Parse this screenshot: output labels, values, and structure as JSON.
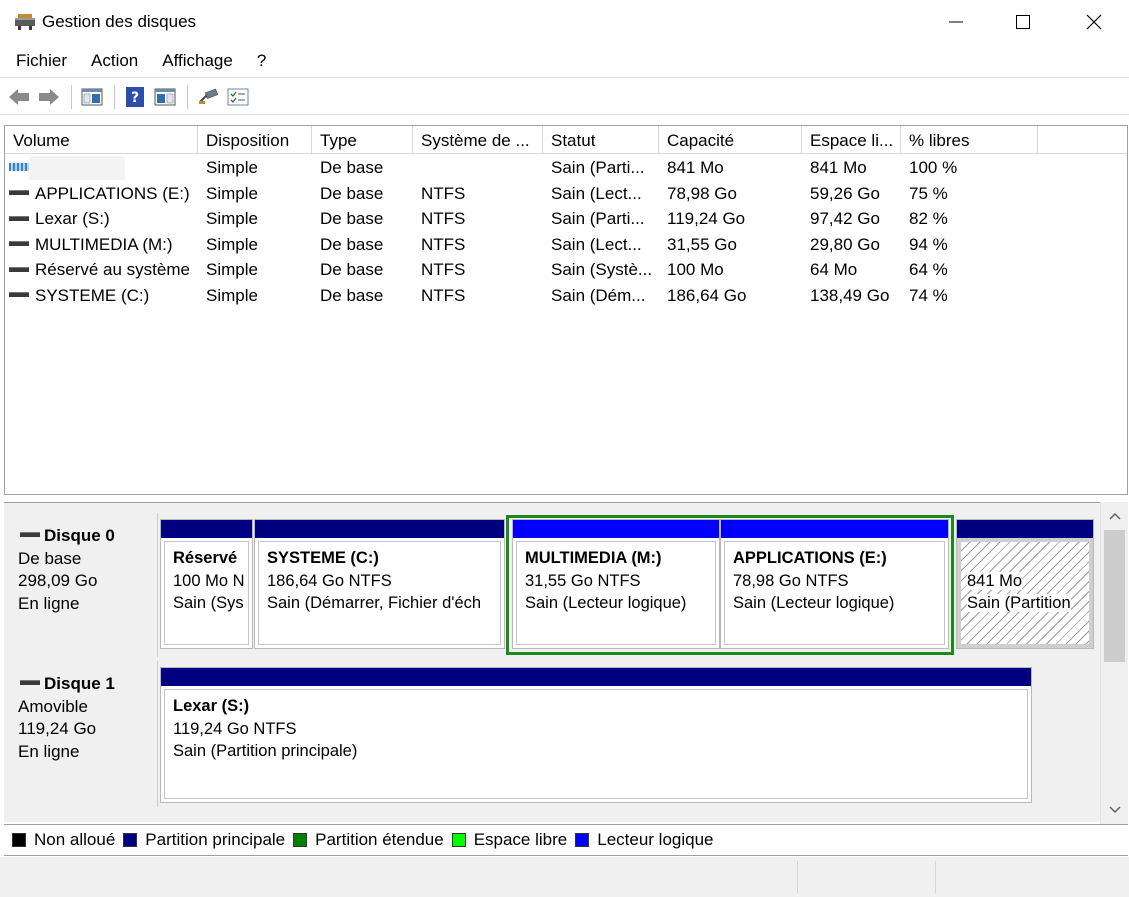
{
  "window": {
    "title": "Gestion des disques",
    "minimize": "—",
    "maximize": "☐",
    "close": "✕"
  },
  "menu": [
    "Fichier",
    "Action",
    "Affichage",
    "?"
  ],
  "toolbar": {
    "icons": [
      "back-arrow-icon",
      "forward-arrow-icon",
      "console-tree-icon",
      "help-icon",
      "properties-pane-icon",
      "connect-icon",
      "checklist-icon"
    ]
  },
  "table": {
    "columns": [
      "Volume",
      "Disposition",
      "Type",
      "Système de ...",
      "Statut",
      "Capacité",
      "Espace li...",
      "% libres"
    ],
    "rows": [
      {
        "volume": "",
        "disposition": "Simple",
        "type": "De base",
        "fs": "",
        "statut": "Sain (Parti...",
        "capacite": "841 Mo",
        "espace": "841 Mo",
        "pct": "100 %"
      },
      {
        "volume": "APPLICATIONS (E:)",
        "disposition": "Simple",
        "type": "De base",
        "fs": "NTFS",
        "statut": "Sain (Lect...",
        "capacite": "78,98 Go",
        "espace": "59,26 Go",
        "pct": "75 %"
      },
      {
        "volume": "Lexar (S:)",
        "disposition": "Simple",
        "type": "De base",
        "fs": "NTFS",
        "statut": "Sain (Parti...",
        "capacite": "119,24 Go",
        "espace": "97,42 Go",
        "pct": "82 %"
      },
      {
        "volume": "MULTIMEDIA (M:)",
        "disposition": "Simple",
        "type": "De base",
        "fs": "NTFS",
        "statut": "Sain (Lect...",
        "capacite": "31,55 Go",
        "espace": "29,80 Go",
        "pct": "94 %"
      },
      {
        "volume": "Réservé au système",
        "disposition": "Simple",
        "type": "De base",
        "fs": "NTFS",
        "statut": "Sain (Systè...",
        "capacite": "100 Mo",
        "espace": "64 Mo",
        "pct": "64 %"
      },
      {
        "volume": "SYSTEME (C:)",
        "disposition": "Simple",
        "type": "De base",
        "fs": "NTFS",
        "statut": "Sain (Dém...",
        "capacite": "186,64 Go",
        "espace": "138,49 Go",
        "pct": "74 %"
      }
    ]
  },
  "disks": [
    {
      "name": "Disque 0",
      "type": "De base",
      "size": "298,09 Go",
      "state": "En ligne",
      "partitions": [
        {
          "name": "Réservé",
          "line2": "100 Mo N",
          "line3": "Sain (Sys",
          "bar_color": "#000080"
        },
        {
          "name": "SYSTEME  (C:)",
          "line2": "186,64 Go NTFS",
          "line3": "Sain (Démarrer, Fichier d'éch",
          "bar_color": "#000080"
        },
        {
          "name": "MULTIMEDIA  (M:)",
          "line2": "31,55 Go NTFS",
          "line3": "Sain (Lecteur logique)",
          "bar_color": "#0000ff"
        },
        {
          "name": "APPLICATIONS  (E:)",
          "line2": "78,98 Go NTFS",
          "line3": "Sain (Lecteur logique)",
          "bar_color": "#0000ff"
        },
        {
          "name": "",
          "line2": "841 Mo",
          "line3": "Sain (Partition",
          "bar_color": "#000080"
        }
      ]
    },
    {
      "name": "Disque 1",
      "type": "Amovible",
      "size": "119,24 Go",
      "state": "En ligne",
      "partitions": [
        {
          "name": "Lexar  (S:)",
          "line2": "119,24 Go NTFS",
          "line3": "Sain (Partition principale)",
          "bar_color": "#000080"
        }
      ]
    }
  ],
  "legend": [
    {
      "label": "Non alloué",
      "color": "#000000"
    },
    {
      "label": "Partition principale",
      "color": "#000080"
    },
    {
      "label": "Partition étendue",
      "color": "#008000"
    },
    {
      "label": "Espace libre",
      "color": "#00ff00"
    },
    {
      "label": "Lecteur logique",
      "color": "#0000ff"
    }
  ],
  "scroll": {
    "up": "^",
    "down": "v"
  }
}
